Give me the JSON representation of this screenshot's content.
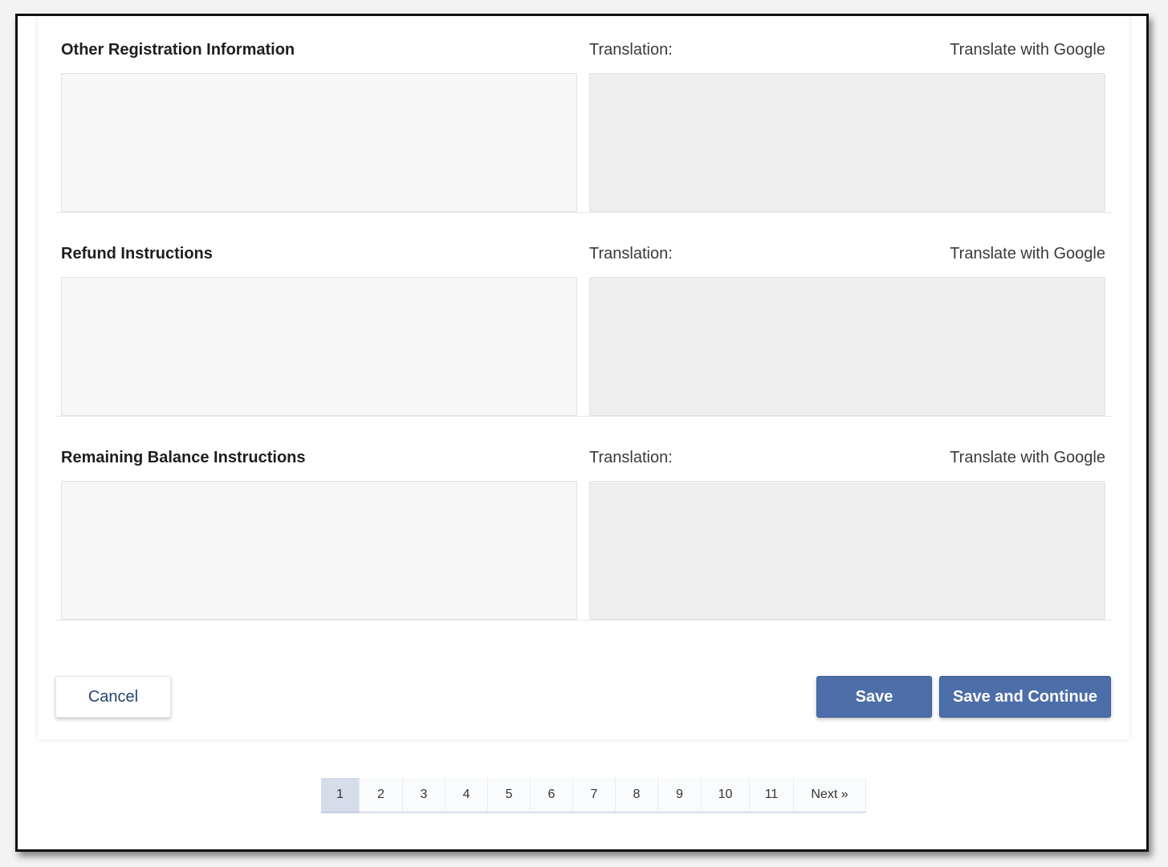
{
  "sections": [
    {
      "title": "Other Registration Information",
      "translation_label": "Translation:",
      "google_label": "Translate with Google",
      "source_value": "",
      "translation_value": ""
    },
    {
      "title": "Refund Instructions",
      "translation_label": "Translation:",
      "google_label": "Translate with Google",
      "source_value": "",
      "translation_value": ""
    },
    {
      "title": "Remaining Balance Instructions",
      "translation_label": "Translation:",
      "google_label": "Translate with Google",
      "source_value": "",
      "translation_value": ""
    }
  ],
  "actions": {
    "cancel_label": "Cancel",
    "save_label": "Save",
    "save_continue_label": "Save and Continue"
  },
  "pagination": {
    "pages": [
      "1",
      "2",
      "3",
      "4",
      "5",
      "6",
      "7",
      "8",
      "9",
      "10",
      "11"
    ],
    "current": "1",
    "next_label": "Next »"
  },
  "colors": {
    "primary_button": "#4d6ea8",
    "cancel_text": "#26466e",
    "active_page": "#d4dde9"
  }
}
